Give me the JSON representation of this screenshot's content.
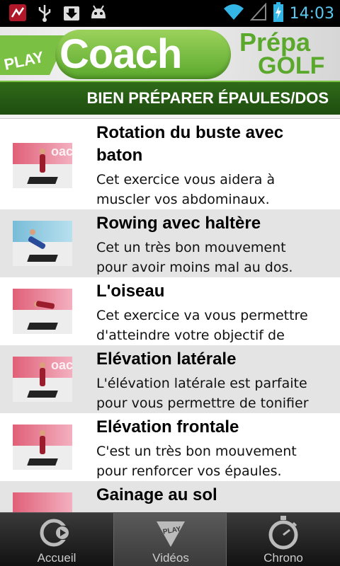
{
  "status": {
    "time": "14:03",
    "icons": [
      "app-activity-icon",
      "usb-icon",
      "download-icon",
      "android-debug-icon",
      "wifi-icon",
      "signal-icon",
      "battery-charging-icon"
    ]
  },
  "banner": {
    "play": "PLAY",
    "coach": "Coach",
    "prepa": "Prépa",
    "golf": "GOLF"
  },
  "section": {
    "title": "BIEN PRÉPARER ÉPAULES/DOS"
  },
  "exercises": [
    {
      "title_line1": "Rotation du buste avec",
      "title_line2": "baton",
      "desc_line1": "Cet exercice vous aidera à",
      "desc_line2": "muscler vos abdominaux."
    },
    {
      "title_line1": "Rowing avec haltère",
      "desc_line1": "Cet un très bon mouvement",
      "desc_line2": "pour avoir moins mal au dos."
    },
    {
      "title_line1": "L'oiseau",
      "desc_line1": "Cet exercice va vous permettre",
      "desc_line2": "d'atteindre votre objectif de"
    },
    {
      "title_line1": "Elévation latérale",
      "desc_line1": "L'élévation latérale est parfaite",
      "desc_line2": "pour vous permettre de tonifier"
    },
    {
      "title_line1": "Elévation frontale",
      "desc_line1": "C'est un très bon mouvement",
      "desc_line2": "pour renforcer vos épaules."
    },
    {
      "title_line1": "Gainage au sol"
    }
  ],
  "thumb_wall_text": "oach",
  "nav": {
    "accueil": "Accueil",
    "videos": "Vidéos",
    "chrono": "Chrono",
    "active": "videos"
  },
  "colors": {
    "accent_green": "#5aa82c",
    "section_bg": "#2e6a18",
    "clock_blue": "#5cc8f0"
  }
}
